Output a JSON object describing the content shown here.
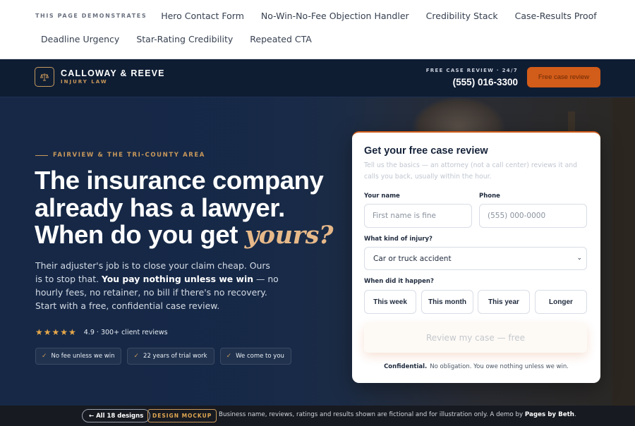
{
  "demo": {
    "label": "THIS PAGE DEMONSTRATES",
    "row1": [
      "Hero Contact Form",
      "No-Win-No-Fee Objection Handler",
      "Credibility Stack",
      "Case-Results Proof"
    ],
    "row2": [
      "Deadline Urgency",
      "Star-Rating Credibility",
      "Repeated CTA"
    ]
  },
  "header": {
    "brand_name": "CALLOWAY & REEVE",
    "brand_sub": "INJURY LAW",
    "availability": "FREE CASE REVIEW · 24/7",
    "phone": "(555) 016-3300",
    "cta_label": "Free case review"
  },
  "hero": {
    "eyebrow": "FAIRVIEW & THE TRI-COUNTY AREA",
    "headline_line1": "The insurance company",
    "headline_line2": "already has a lawyer.",
    "headline_line3_pre": "When do you get ",
    "headline_accent": "yours?",
    "lede_pre": "Their adjuster's job is to close your claim cheap. Ours is to stop that. ",
    "lede_bold": "You pay nothing unless we win",
    "lede_post": " — no hourly fees, no retainer, no bill if there's no recovery. Start with a free, confidential case review.",
    "stars": "★★★★★",
    "rating_text": "4.9 · 300+ client reviews",
    "badges": [
      "No fee unless we win",
      "22 years of trial work",
      "We come to you"
    ]
  },
  "form": {
    "title": "Get your free case review",
    "subtitle": "Tell us the basics — an attorney (not a call center) reviews it and calls you back, usually within the hour.",
    "name_label": "Your name",
    "name_placeholder": "First name is fine",
    "phone_label": "Phone",
    "phone_placeholder": "(555) 000-0000",
    "injury_label": "What kind of injury?",
    "injury_selected": "Car or truck accident",
    "when_label": "When did it happen?",
    "when_options": [
      "This week",
      "This month",
      "This year",
      "Longer"
    ],
    "submit_label": "Review my case — free",
    "footer_bold": "Confidential.",
    "footer_text": "No obligation. You owe nothing unless we win."
  },
  "bottom": {
    "back_label": "← All 18 designs",
    "tag": "DESIGN MOCKUP",
    "disclaimer": "Business name, reviews, ratings and results shown are fictional and for illustration only. A demo by ",
    "author": "Pages by Beth",
    "period": "."
  },
  "colors": {
    "navy": "#0f1d33",
    "accent": "#d25c19",
    "gold": "#c9985a"
  }
}
